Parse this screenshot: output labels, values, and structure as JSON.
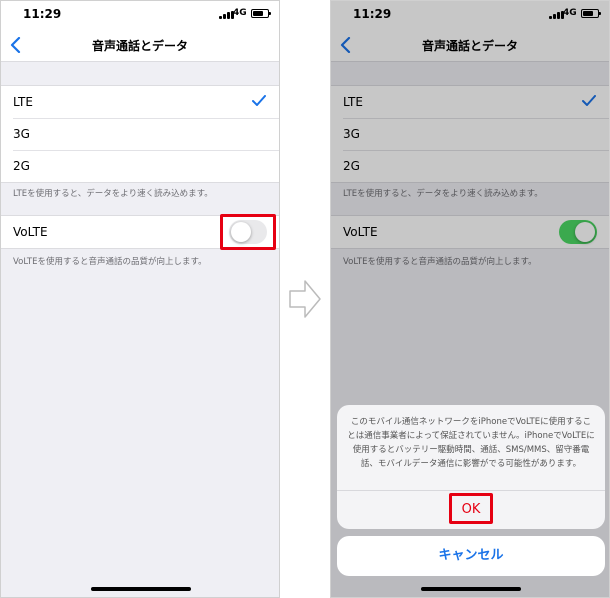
{
  "status": {
    "time": "11:29",
    "network": "4G"
  },
  "nav": {
    "title": "音声通話とデータ"
  },
  "voice_data": {
    "options": [
      {
        "label": "LTE",
        "selected": true
      },
      {
        "label": "3G",
        "selected": false
      },
      {
        "label": "2G",
        "selected": false
      }
    ],
    "footnote": "LTEを使用すると、データをより速く読み込めます。"
  },
  "volte": {
    "label": "VoLTE",
    "footnote": "VoLTEを使用すると音声通話の品質が向上します。",
    "before_enabled": false,
    "after_enabled": true
  },
  "alert": {
    "message": "このモバイル通信ネットワークをiPhoneでVoLTEに使用することは通信事業者によって保証されていません。iPhoneでVoLTEに使用するとバッテリー駆動時間、通話、SMS/MMS、留守番電話、モバイルデータ通信に影響がでる可能性があります。",
    "ok_label": "OK",
    "cancel_label": "キャンセル"
  },
  "colors": {
    "highlight": "#e60012",
    "toggle_on": "#4cd964",
    "toggle_off": "#e9e9eb",
    "accent_blue": "#1a73e8",
    "group_bg": "#efeff4"
  },
  "icons": {
    "back": "chevron-left-icon",
    "check": "checkmark-icon",
    "arrow": "arrow-right-icon",
    "battery": "battery-icon",
    "signal": "signal-icon"
  }
}
